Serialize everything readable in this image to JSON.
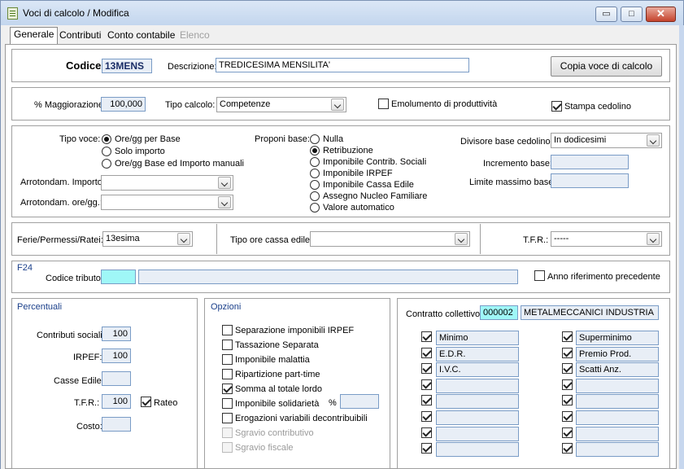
{
  "window": {
    "title": "Voci di calcolo / Modifica",
    "min_glyph": "▭",
    "max_glyph": "□",
    "close_glyph": "✕"
  },
  "tabs": [
    {
      "label": "Generale"
    },
    {
      "label": "Contributi"
    },
    {
      "label": "Conto contabile"
    },
    {
      "label": "Elenco"
    }
  ],
  "header": {
    "codice_label": "Codice:",
    "codice_value": "13MENS",
    "descrizione_label": "Descrizione:",
    "descrizione_value": "TREDICESIMA MENSILITA'",
    "copia_button": "Copia voce di calcolo"
  },
  "calc": {
    "magg_label": "% Maggiorazione:",
    "magg_value": "100,000",
    "tipo_label": "Tipo calcolo:",
    "tipo_value": "Competenze",
    "emolumento_label": "Emolumento di produttività",
    "emolumento_checked": false,
    "stampa_label": "Stampa cedolino",
    "stampa_checked": true
  },
  "voce": {
    "tipo_label": "Tipo voce:",
    "tipo_options": [
      "Ore/gg per Base",
      "Solo importo",
      "Ore/gg Base ed Importo manuali"
    ],
    "tipo_selected": 0,
    "arr_importo_label": "Arrotondam. Importo:",
    "arr_importo_value": "",
    "arr_ore_label": "Arrotondam. ore/gg.:",
    "arr_ore_value": "",
    "proponi_label": "Proponi base:",
    "proponi_options": [
      "Nulla",
      "Retribuzione",
      "Imponibile Contrib. Sociali",
      "Imponibile IRPEF",
      "Imponibile Cassa Edile",
      "Assegno Nucleo Familiare",
      "Valore automatico"
    ],
    "proponi_selected": 1,
    "divisore_label": "Divisore base cedolino:",
    "divisore_value": "In dodicesimi",
    "incremento_label": "Incremento base:",
    "incremento_value": "",
    "limite_label": "Limite massimo base:",
    "limite_value": ""
  },
  "ferie": {
    "label": "Ferie/Permessi/Ratei:",
    "value": "13esima",
    "ore_cassa_label": "Tipo ore cassa edile:",
    "ore_cassa_value": "",
    "tfr_label": "T.F.R.:",
    "tfr_value": "-----"
  },
  "f24": {
    "section": "F24",
    "codice_label": "Codice tributo:",
    "codice_value": "",
    "descr_value": "",
    "anno_label": "Anno riferimento precedente",
    "anno_checked": false
  },
  "percentuali": {
    "section": "Percentuali",
    "contributi_label": "Contributi sociali:",
    "contributi_value": "100",
    "irpef_label": "IRPEF:",
    "irpef_value": "100",
    "casse_label": "Casse Edile:",
    "casse_value": "",
    "tfr_label": "T.F.R.:",
    "tfr_value": "100",
    "rateo_label": "Rateo",
    "rateo_checked": true,
    "costo_label": "Costo:",
    "costo_value": ""
  },
  "opzioni": {
    "section": "Opzioni",
    "items": [
      {
        "label": "Separazione imponibili IRPEF",
        "checked": false,
        "disabled": false
      },
      {
        "label": "Tassazione Separata",
        "checked": false,
        "disabled": false
      },
      {
        "label": "Imponibile malattia",
        "checked": false,
        "disabled": false
      },
      {
        "label": "Ripartizione part-time",
        "checked": false,
        "disabled": false
      },
      {
        "label": "Somma al totale lordo",
        "checked": true,
        "disabled": false
      },
      {
        "label": "Imponibile solidarietà",
        "checked": false,
        "disabled": false
      },
      {
        "label": "Erogazioni variabili decontribuibili",
        "checked": false,
        "disabled": false
      },
      {
        "label": "Sgravio contributivo",
        "checked": false,
        "disabled": true
      },
      {
        "label": "Sgravio fiscale",
        "checked": false,
        "disabled": true
      }
    ],
    "percent_symbol": "%",
    "percent_value": ""
  },
  "contratto": {
    "label": "Contratto collettivo:",
    "code": "000002",
    "name": "METALMECCANICI INDUSTRIA",
    "left": [
      {
        "label": "Minimo",
        "checked": true
      },
      {
        "label": "E.D.R.",
        "checked": true
      },
      {
        "label": "I.V.C.",
        "checked": true
      },
      {
        "label": "",
        "checked": true
      },
      {
        "label": "",
        "checked": true
      },
      {
        "label": "",
        "checked": true
      },
      {
        "label": "",
        "checked": true
      },
      {
        "label": "",
        "checked": true
      }
    ],
    "right": [
      {
        "label": "Superminimo",
        "checked": true
      },
      {
        "label": "Premio Prod.",
        "checked": true
      },
      {
        "label": "Scatti Anz.",
        "checked": true
      },
      {
        "label": "",
        "checked": true
      },
      {
        "label": "",
        "checked": true
      },
      {
        "label": "",
        "checked": true
      },
      {
        "label": "",
        "checked": true
      },
      {
        "label": "",
        "checked": true
      }
    ]
  }
}
